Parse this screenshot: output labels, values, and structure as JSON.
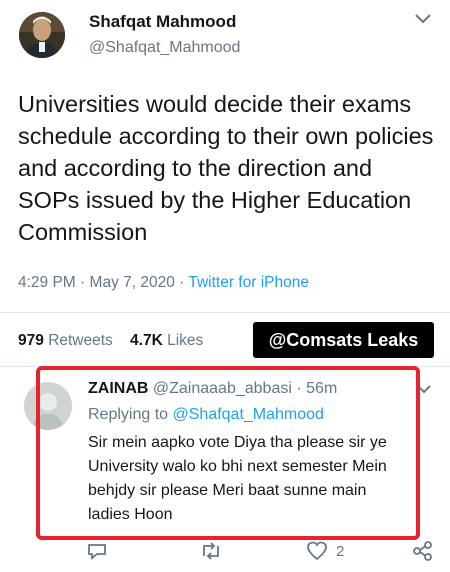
{
  "author": {
    "name": "Shafqat Mahmood",
    "handle": "@Shafqat_Mahmood"
  },
  "tweet": {
    "text": "Universities would decide their exams schedule according to their own policies and according to the direction and SOPs issued by the Higher Education Commission",
    "time": "4:29 PM",
    "date": "May 7, 2020",
    "separator": "·",
    "source": "Twitter for iPhone"
  },
  "stats": {
    "retweets_count": "979",
    "retweets_label": "Retweets",
    "likes_count": "4.7K",
    "likes_label": "Likes"
  },
  "watermark": "@Comsats Leaks",
  "reply": {
    "name": "ZAINAB",
    "handle": "@Zainaaab_abbasi",
    "separator": "·",
    "age": "56m",
    "replying_prefix": "Replying to",
    "replying_to": "@Shafqat_Mahmood",
    "text": "Sir mein aapko vote Diya tha please sir ye\nUniversity walo ko bhi next semester Mein\nbehjdy sir please Meri baat sunne main\nladies Hoon",
    "like_count": "2"
  },
  "colors": {
    "accent": "#1da1f2",
    "highlight_box": "#e8232f",
    "muted": "#657786"
  }
}
